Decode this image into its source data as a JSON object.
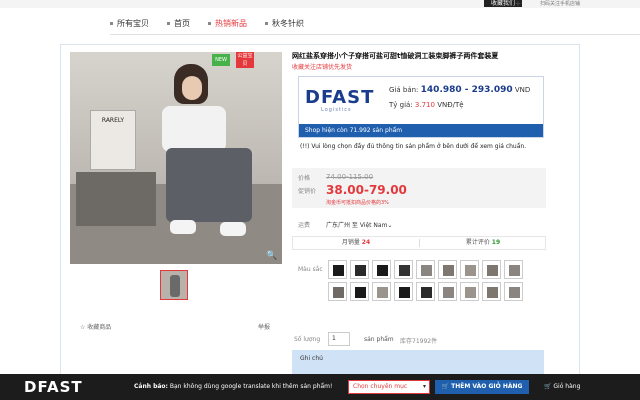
{
  "header": {
    "favorite_button": "收藏我们",
    "qr_text": "扫码关注手机店铺",
    "nav": [
      "所有宝贝",
      "首页",
      "热销新品",
      "秋冬针织"
    ]
  },
  "product": {
    "badge_new": "NEW",
    "badge_sale": "公益宝贝",
    "poster_text": "RARELY",
    "title": "网红盐系穿搭小个子穿搭可盐可甜t恤破洞工装束脚裤子两件套装夏",
    "subtitle": "收藏关注店铺优先发货",
    "favorite_link": "收藏商品",
    "report_link": "举报"
  },
  "dfast": {
    "logo": "DFAST",
    "logo_sub": "Logistics",
    "price_label": "Giá bán:",
    "price_range": "140.980 - 293.090",
    "price_currency": "VND",
    "rate_label": "Tỷ giá:",
    "rate_value": "3.710",
    "rate_unit": "VNĐ/Tệ",
    "stock_text": "Shop hiện còn",
    "stock_count": "71.992",
    "stock_unit": "sản phẩm",
    "notice": "(!!) Vui lòng chọn đầy đủ thông tin sản phẩm ở bên dưới để xem giá chuẩn."
  },
  "pricing": {
    "old_label": "价格",
    "old_price": "74.00-115.00",
    "new_label": "促销价",
    "new_price": "38.00-79.00",
    "promo": "淘金币可抵扣商品价格的3%"
  },
  "shipping": {
    "label": "运费",
    "value": "广东广州 至 Việt Nam"
  },
  "stats": {
    "monthly_label": "月销量",
    "monthly_value": "24",
    "reviews_label": "累计评价",
    "reviews_value": "19"
  },
  "options": {
    "color_label": "Màu sắc",
    "swatch_count": 18
  },
  "quantity": {
    "label": "Số lượng",
    "value": "1",
    "unit": "sản phẩm",
    "stock": "库存71992件"
  },
  "note": {
    "label": "Ghi chú"
  },
  "bottom_bar": {
    "logo": "DFAST",
    "warning_bold": "Cảnh báo:",
    "warning_text": "Bạn không dùng google translate khi thêm sản phẩm!",
    "select_placeholder": "Chọn chuyên mục",
    "add_button": "THÊM VÀO GIỎ HÀNG",
    "cart_button": "Giỏ hàng"
  },
  "colors": {
    "accent_red": "#e4393c",
    "brand_blue": "#1f5fae",
    "bar_dark": "#1c1c1c"
  }
}
